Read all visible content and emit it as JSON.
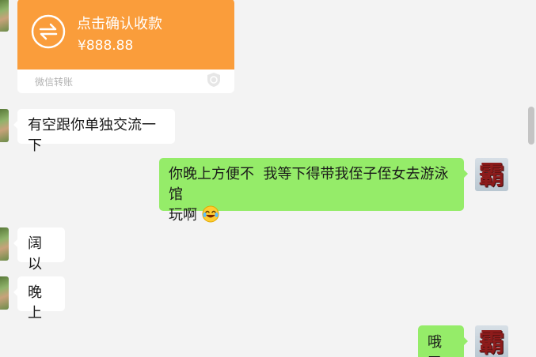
{
  "transfer": {
    "title": "点击确认收款",
    "amount": "¥888.88",
    "source": "微信转账",
    "icon": "transfer-arrows-icon",
    "accent": "#fa9d3b"
  },
  "messages": [
    {
      "side": "in",
      "text": "有空跟你单独交流一下"
    },
    {
      "side": "out",
      "text": "你晚上方便不  我等下得带我侄子侄女去游泳馆",
      "text2": "玩啊",
      "emoji": "laughing-tears-emoji"
    },
    {
      "side": "in",
      "text": "阔以"
    },
    {
      "side": "in",
      "text": "晚上"
    },
    {
      "side": "out",
      "text": "哦了"
    }
  ],
  "avatars": {
    "self_glyph": "霸"
  },
  "colors": {
    "background": "#f3f3f3",
    "outgoing_bubble": "#95ec69",
    "incoming_bubble": "#ffffff"
  }
}
